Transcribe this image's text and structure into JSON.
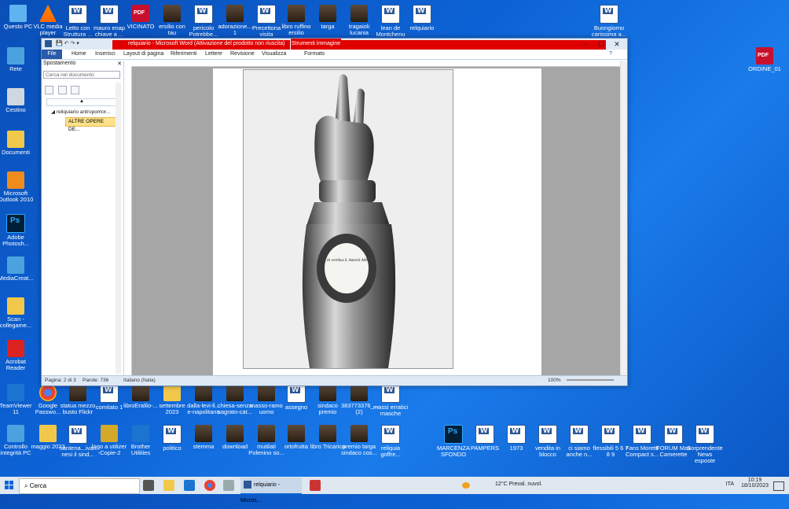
{
  "desktop_icons": [
    {
      "label": "Questo PC",
      "icon": "pc-icon"
    },
    {
      "label": "VLC media player",
      "icon": "vlc-icon"
    },
    {
      "label": "Letto con Struttura ...",
      "icon": "word-doc-icon"
    },
    {
      "label": "mauro enap chiave a ...",
      "icon": "word-doc-icon"
    },
    {
      "label": "VICINATO",
      "icon": "pdf-icon"
    },
    {
      "label": "ersilio con tau",
      "icon": "photo-icon"
    },
    {
      "label": "pericolo Potrebbe...",
      "icon": "word-doc-icon"
    },
    {
      "label": "adorazione... 1",
      "icon": "photo-icon"
    },
    {
      "label": "Precettona visita",
      "icon": "word-doc-icon"
    },
    {
      "label": "libro ruffino ersilio",
      "icon": "photo-icon"
    },
    {
      "label": "targa",
      "icon": "photo-icon"
    },
    {
      "label": "tragaioli lucania",
      "icon": "photo-icon"
    },
    {
      "label": "lean de Montchenu",
      "icon": "word-doc-icon"
    },
    {
      "label": "relquiario",
      "icon": "word-doc-icon"
    },
    {
      "label": "Buongiorno carissima a...",
      "icon": "word-doc-icon"
    },
    {
      "label": "Rete",
      "icon": "network-icon"
    },
    {
      "label": "ORDINE_01",
      "icon": "pdf-icon"
    },
    {
      "label": "Cestino",
      "icon": "recycle-bin-icon"
    },
    {
      "label": "Documenti",
      "icon": "folder-icon"
    },
    {
      "label": "Microsoft Outlook 2010",
      "icon": "outlook-icon"
    },
    {
      "label": "Adobe Photosh...",
      "icon": "photoshop-icon"
    },
    {
      "label": "MediaCreat...",
      "icon": "app-icon"
    },
    {
      "label": "Scan - collegame...",
      "icon": "shortcut-icon"
    },
    {
      "label": "Acrobat Reader",
      "icon": "acrobat-icon"
    },
    {
      "label": "TeamViewer 11",
      "icon": "teamviewer-icon"
    },
    {
      "label": "Google Passwo...",
      "icon": "chrome-icon"
    },
    {
      "label": "statua mezzo busto Flickr",
      "icon": "photo-icon"
    },
    {
      "label": "comitato 1",
      "icon": "word-doc-icon"
    },
    {
      "label": "libroEralilo-...",
      "icon": "photo-icon"
    },
    {
      "label": "settembre 2023",
      "icon": "folder-icon"
    },
    {
      "label": "dalla-levi-ll... e-napolitano",
      "icon": "photo-icon"
    },
    {
      "label": "chiesa-senza sagrato-cat...",
      "icon": "photo-icon"
    },
    {
      "label": "masso-ramo uomo",
      "icon": "photo-icon"
    },
    {
      "label": "assegno",
      "icon": "word-doc-icon"
    },
    {
      "label": "sindaco premio",
      "icon": "photo-icon"
    },
    {
      "label": "383773376_... (2)",
      "icon": "photo-icon"
    },
    {
      "label": "massi erratici masche",
      "icon": "word-doc-icon"
    },
    {
      "label": "Controllo integrità PC",
      "icon": "health-icon"
    },
    {
      "label": "maggio 2023",
      "icon": "folder-icon"
    },
    {
      "label": "santena...ivan nesi il sind...",
      "icon": "word-doc-icon"
    },
    {
      "label": "logo a utilizer -Copie-2",
      "icon": "logo-icon"
    },
    {
      "label": "Brother Utilities",
      "icon": "brother-icon"
    },
    {
      "label": "politico",
      "icon": "word-doc-icon"
    },
    {
      "label": "stemma",
      "icon": "photo-icon"
    },
    {
      "label": "download",
      "icon": "photo-icon"
    },
    {
      "label": "mutilati Polenino so...",
      "icon": "photo-icon"
    },
    {
      "label": "ortofrutta",
      "icon": "photo-icon"
    },
    {
      "label": "libro Tricarico",
      "icon": "photo-icon"
    },
    {
      "label": "premio targa sindaco cos...",
      "icon": "photo-icon"
    },
    {
      "label": "reliquia goffre...",
      "icon": "word-doc-icon"
    },
    {
      "label": "MARCENZA SFONDO",
      "icon": "photoshop-icon"
    },
    {
      "label": "PAMPERS",
      "icon": "word-doc-icon"
    },
    {
      "label": "1973",
      "icon": "word-doc-icon"
    },
    {
      "label": "vendita in blocco",
      "icon": "word-doc-icon"
    },
    {
      "label": "ci siamo anche n...",
      "icon": "word-doc-icon"
    },
    {
      "label": "flessibili 5 6 7 8 9",
      "icon": "word-doc-icon"
    },
    {
      "label": "Fans Moretti Compact s...",
      "icon": "word-doc-icon"
    },
    {
      "label": "FORUM Max Camerette",
      "icon": "word-doc-icon"
    },
    {
      "label": "Sorprendente News esposte",
      "icon": "word-doc-icon"
    }
  ],
  "word": {
    "title": "relquiario  -  Microsoft Word (Attivazione del prodotto non riuscita)",
    "context_tab": "Strumenti immagine",
    "tabs": [
      "File",
      "Home",
      "Inserisci",
      "Layout di pagina",
      "Riferimenti",
      "Lettere",
      "Revisione",
      "Visualizza",
      "Formato"
    ],
    "nav": {
      "title": "Spostamento",
      "search_placeholder": "Cerca nel documento",
      "heading1": "reliquiario antropomor...",
      "heading2": "ALTRE OPERE DE..."
    },
    "image_caption": "In vertibus S. Antonii Abb",
    "status": {
      "page": "Pagina: 2 di 3",
      "words": "Parole: 736",
      "language": "Italiano (Italia)",
      "zoom": "100%"
    }
  },
  "taskbar": {
    "search_placeholder": "Cerca",
    "active_task": "relquiario - Micros...",
    "weather": "12°C  Preval. nuvol.",
    "lang": "ITA",
    "time": "10:19",
    "date": "18/10/2023"
  },
  "colors": {
    "desktop": "#0d63d6",
    "title_accent": "#e00000",
    "file_tab": "#2a5aa8"
  }
}
